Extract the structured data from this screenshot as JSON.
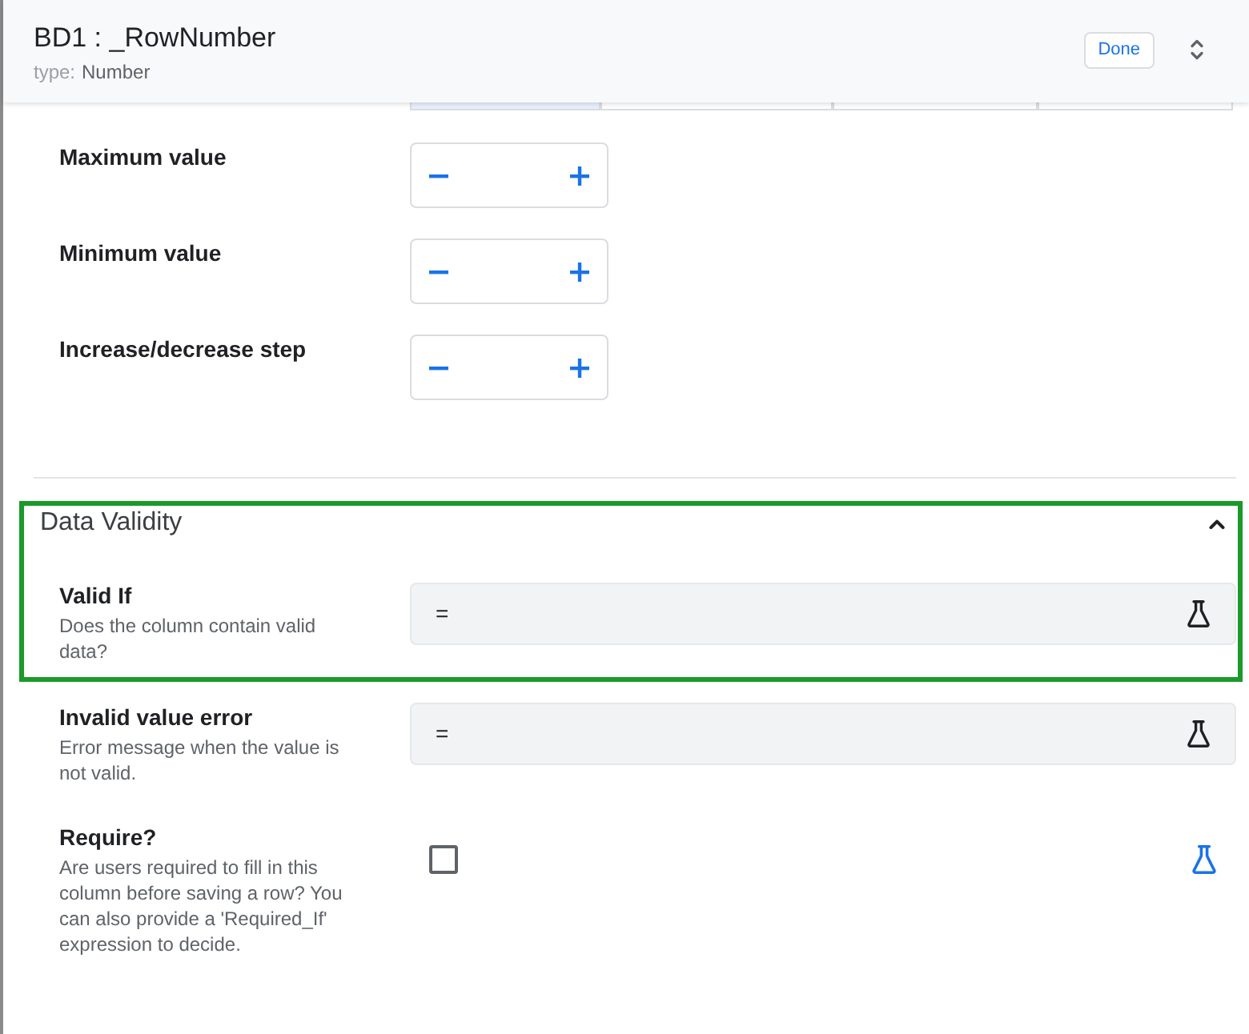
{
  "header": {
    "title": "BD1 : _RowNumber",
    "type_label": "type:",
    "type_value": "Number",
    "done_button": "Done"
  },
  "segmented_control": {
    "segments": [
      {
        "selected": true
      },
      {
        "selected": false
      },
      {
        "selected": false
      },
      {
        "selected": false
      }
    ]
  },
  "number_settings": [
    {
      "label": "Maximum value"
    },
    {
      "label": "Minimum value"
    },
    {
      "label": "Increase/decrease step"
    }
  ],
  "data_validity": {
    "title": "Data Validity",
    "expanded": true,
    "highlighted": true,
    "highlighted_rows": [
      {
        "kind": "expression",
        "label": "Valid If",
        "description": "Does the column contain valid data?",
        "value": "="
      }
    ],
    "rows": [
      {
        "kind": "expression",
        "label": "Invalid value error",
        "description": "Error message when the value is not valid.",
        "value": "="
      },
      {
        "kind": "checkbox",
        "label": "Require?",
        "description": "Are users required to fill in this column before saving a row? You can also provide a 'Required_If' expression to decide.",
        "checked": false
      }
    ]
  }
}
